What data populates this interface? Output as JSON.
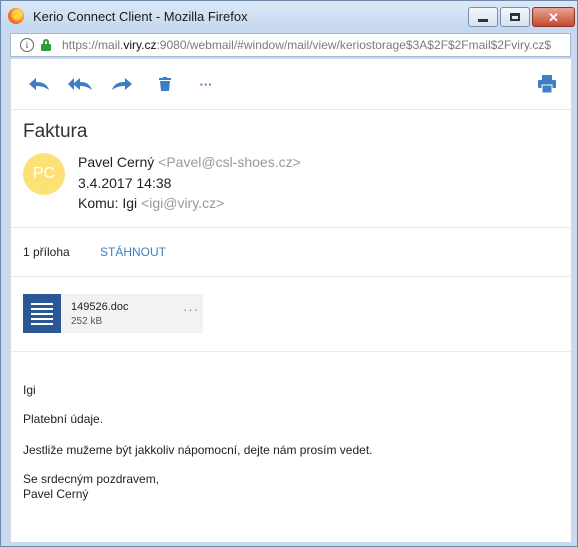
{
  "window": {
    "title": "Kerio Connect Client - Mozilla Firefox",
    "url_prefix": "https://mail.",
    "url_host": "viry.cz",
    "url_rest": ":9080/webmail/#window/mail/view/keriostorage$3A$2F$2Fmail$2Fviry.cz$"
  },
  "toolbar": {
    "icons": [
      "reply-icon",
      "reply-all-icon",
      "forward-icon",
      "delete-icon",
      "more-icon",
      "print-icon"
    ],
    "more_label": "···"
  },
  "message": {
    "subject": "Faktura",
    "avatar_initials": "PC",
    "from_name": "Pavel Cerný",
    "from_email": "<Pavel@csl-shoes.cz>",
    "date": "3.4.2017 14:38",
    "to_label": "Komu:",
    "to_name": "Igi",
    "to_email": "<igi@viry.cz>"
  },
  "attachments": {
    "count_label": "1 příloha",
    "download_label": "STÁHNOUT",
    "files": [
      {
        "name": "149526.doc",
        "size": "252 kB",
        "more": "···"
      }
    ]
  },
  "body": {
    "lines": [
      "Igi",
      "Platební údaje.",
      "Jestliže mužeme být jakkoliv nápomocní, dejte nám prosím vedet.",
      "Se srdecným pozdravem,",
      "Pavel Cerný"
    ]
  },
  "colors": {
    "accent": "#3d7fc4",
    "avatar": "#fde076",
    "doc_icon": "#2b5797"
  }
}
